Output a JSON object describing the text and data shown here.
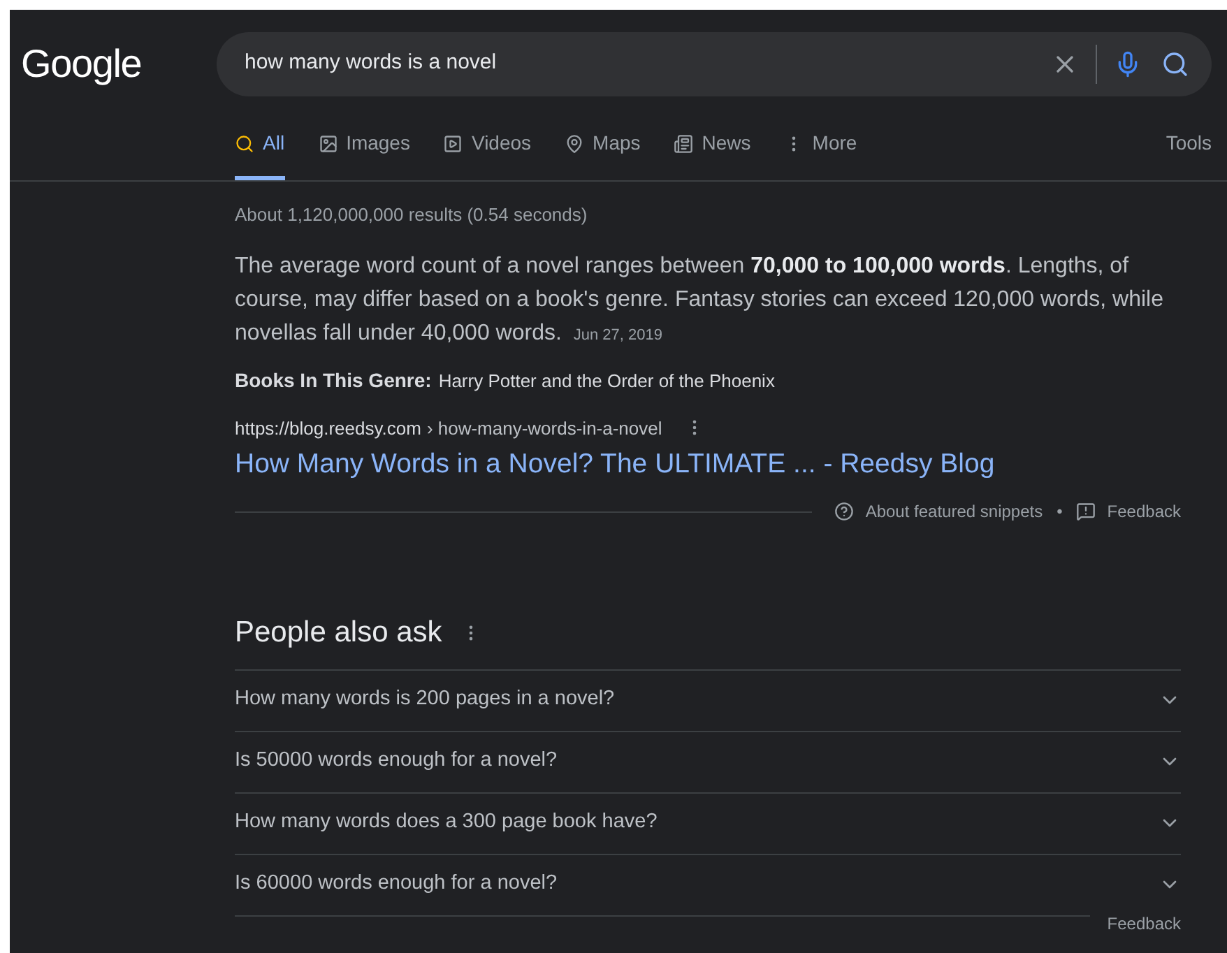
{
  "logo": "Google",
  "search": {
    "value": "how many words is a novel"
  },
  "tabs": [
    {
      "label": "All",
      "selected": true
    },
    {
      "label": "Images",
      "selected": false
    },
    {
      "label": "Videos",
      "selected": false
    },
    {
      "label": "Maps",
      "selected": false
    },
    {
      "label": "News",
      "selected": false
    },
    {
      "label": "More",
      "selected": false
    }
  ],
  "tools": "Tools",
  "result_stats": "About 1,120,000,000 results (0.54 seconds)",
  "snippet": {
    "text": "The average word count of a novel ranges between **70,000 to 100,000 words**. Lengths, of course, may differ based on a book's genre. Fantasy stories can exceed 120,000 words, while novellas fall under 40,000 words.",
    "date": "Jun 27, 2019",
    "genre_label": "Books In This Genre:",
    "genre_value": "Harry Potter and the Order of the Phoenix",
    "url_host": "https://blog.reedsy.com",
    "url_path": "› how-many-words-in-a-novel",
    "title": "How Many Words in a Novel? The ULTIMATE ... - Reedsy Blog",
    "about": "About featured snippets",
    "separator": "•",
    "feedback": "Feedback"
  },
  "people_also_ask": {
    "title": "People also ask",
    "questions": [
      {
        "text": "How many words is 200 pages in a novel?",
        "expanded": false
      },
      {
        "text": "Is 50000 words enough for a novel?",
        "expanded": false
      },
      {
        "text": "How many words does a 300 page book have?",
        "expanded": false
      },
      {
        "text": "Is 60000 words enough for a novel?",
        "expanded": false
      }
    ],
    "feedback": "Feedback"
  }
}
